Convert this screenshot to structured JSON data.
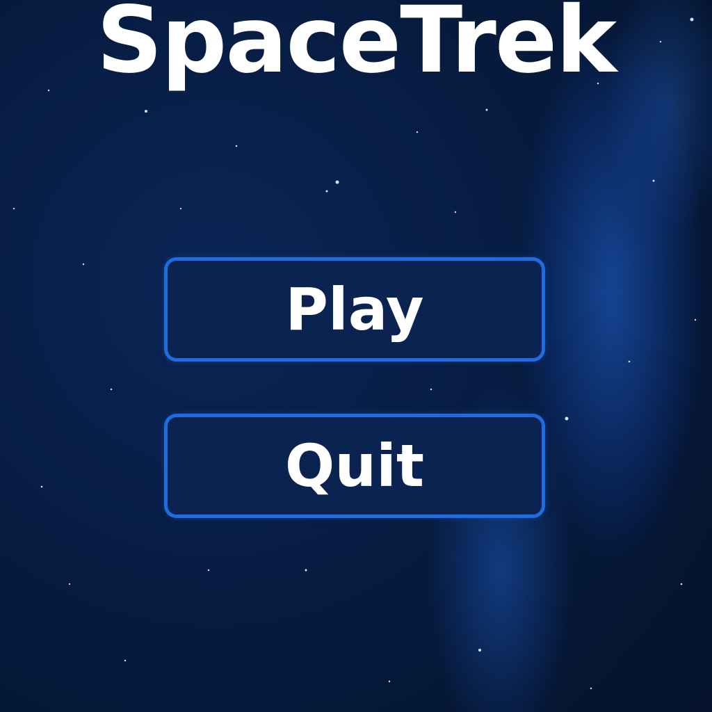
{
  "game": {
    "title": "SpaceTrek"
  },
  "menu": {
    "play_label": "Play",
    "quit_label": "Quit"
  },
  "colors": {
    "background": "#061a3d",
    "button_fill": "#0b2350",
    "button_border": "#1f6be0",
    "text": "#ffffff"
  }
}
